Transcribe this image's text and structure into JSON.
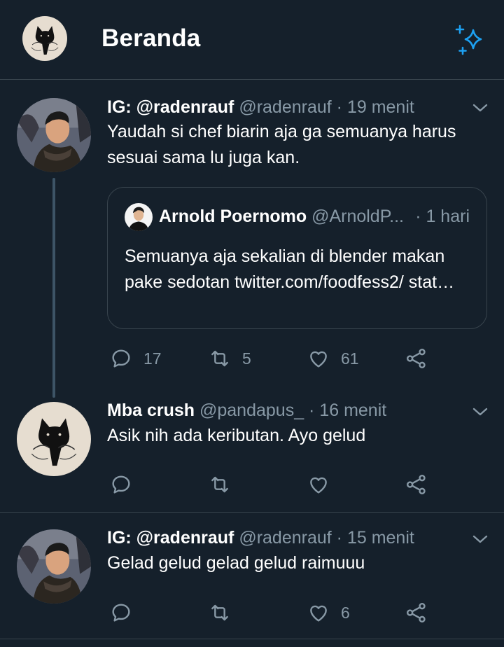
{
  "header": {
    "title": "Beranda",
    "sparkle_icon": "sparkle-icon"
  },
  "colors": {
    "background": "#15202b",
    "secondary_text": "#8899a6",
    "accent": "#1da1f2",
    "border": "#38444d"
  },
  "tweets": [
    {
      "name": "IG: @radenrauf",
      "handle": "@radenrauf",
      "time": "· 19 menit",
      "text": "Yaudah si chef biarin aja ga semuanya harus sesuai sama lu juga kan.",
      "quote": {
        "name": "Arnold Poernomo",
        "handle": "@ArnoldP...",
        "time": "· 1 hari",
        "text": "Semuanya aja sekalian di blender makan pake sedotan twitter.com/foodfess2/ stat…"
      },
      "replies": "17",
      "retweets": "5",
      "likes": "61"
    },
    {
      "name": "Mba crush",
      "handle": "@pandapus_",
      "time": "· 16 menit",
      "text": "Asik nih ada keributan. Ayo gelud",
      "replies": "",
      "retweets": "",
      "likes": ""
    },
    {
      "name": "IG: @radenrauf",
      "handle": "@radenrauf",
      "time": "· 15 menit",
      "text": "Gelad gelud gelad gelud raimuuu",
      "replies": "",
      "retweets": "",
      "likes": "6"
    }
  ]
}
